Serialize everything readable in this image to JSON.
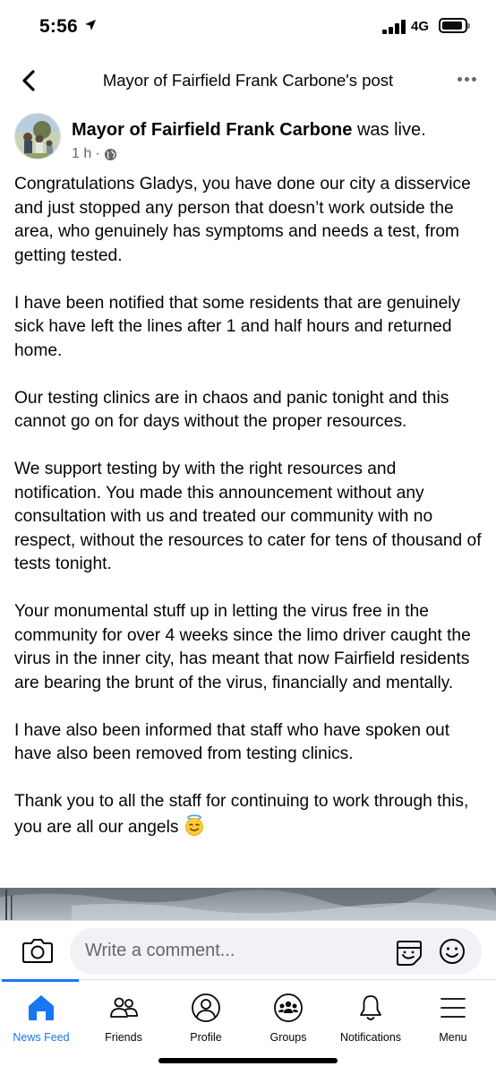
{
  "status_bar": {
    "time": "5:56",
    "network": "4G"
  },
  "header": {
    "title": "Mayor of Fairfield Frank Carbone's post"
  },
  "post": {
    "author": "Mayor of Fairfield Frank Carbone",
    "action": " was live.",
    "time": "1 h",
    "separator": "·",
    "paragraphs": [
      "Congratulations Gladys, you have done our city a disservice and just stopped any person that doesn’t work outside the area, who genuinely has symptoms and needs a test, from getting tested.",
      "I have been notified that some residents that are genuinely sick have left the lines after 1 and half hours and returned home.",
      "Our testing clinics are in chaos and panic  tonight and this cannot go on for days without the proper resources.",
      "We support testing by with the right resources and notification. You made this announcement without any consultation with us and treated our community with no respect, without the resources to cater for tens of thousand of tests tonight.",
      "Your monumental stuff up in letting the virus free in the community for over 4 weeks since the limo driver caught the virus in the inner city, has meant that now Fairfield residents are bearing the brunt of the virus, financially and mentally.",
      "I have also been informed that staff who have spoken out have also been removed from testing clinics.",
      "Thank you to all the staff for continuing to work through this, you are all our angels"
    ]
  },
  "comment": {
    "placeholder": "Write a comment..."
  },
  "tabs": [
    {
      "label": "News Feed",
      "icon": "home-icon",
      "active": true
    },
    {
      "label": "Friends",
      "icon": "friends-icon",
      "active": false
    },
    {
      "label": "Profile",
      "icon": "profile-icon",
      "active": false
    },
    {
      "label": "Groups",
      "icon": "groups-icon",
      "active": false
    },
    {
      "label": "Notifications",
      "icon": "bell-icon",
      "active": false
    },
    {
      "label": "Menu",
      "icon": "menu-icon",
      "active": false
    }
  ],
  "colors": {
    "accent": "#1877f2",
    "secondary_text": "#65676b",
    "input_bg": "#f0f2f5"
  }
}
